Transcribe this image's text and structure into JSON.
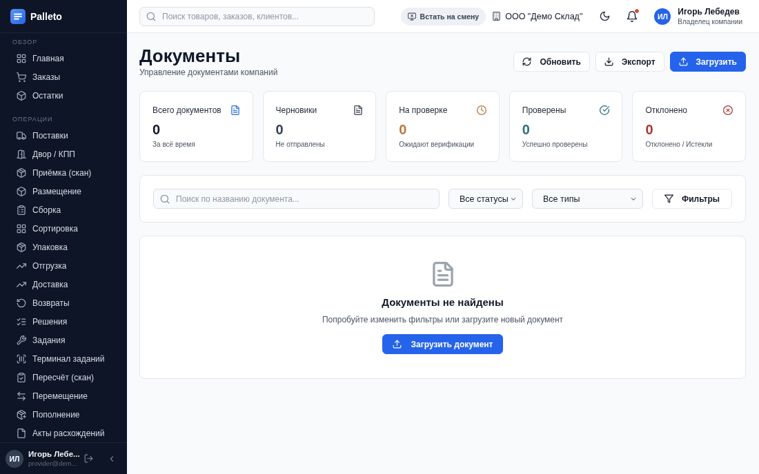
{
  "brand": {
    "name": "Palleto"
  },
  "sidebar": {
    "sections": [
      {
        "title": "ОБЗОР",
        "items": [
          {
            "label": "Главная",
            "selected": false
          },
          {
            "label": "Заказы",
            "selected": false
          },
          {
            "label": "Остатки",
            "selected": false
          }
        ]
      },
      {
        "title": "ОПЕРАЦИИ",
        "items": [
          {
            "label": "Поставки",
            "selected": false
          },
          {
            "label": "Двор / КПП",
            "selected": false
          },
          {
            "label": "Приёмка (скан)",
            "selected": false
          },
          {
            "label": "Размещение",
            "selected": false
          },
          {
            "label": "Сборка",
            "selected": false
          },
          {
            "label": "Сортировка",
            "selected": false
          },
          {
            "label": "Упаковка",
            "selected": false
          },
          {
            "label": "Отгрузка",
            "selected": false
          },
          {
            "label": "Доставка",
            "selected": false
          },
          {
            "label": "Возвраты",
            "selected": false
          },
          {
            "label": "Решения",
            "selected": false
          },
          {
            "label": "Задания",
            "selected": false
          },
          {
            "label": "Терминал заданий",
            "selected": false
          },
          {
            "label": "Пересчёт (скан)",
            "selected": false
          },
          {
            "label": "Перемещение",
            "selected": false
          },
          {
            "label": "Пополнение",
            "selected": false
          },
          {
            "label": "Акты расхождений",
            "selected": false
          }
        ]
      }
    ]
  },
  "sidebar_footer": {
    "avatar": "ИЛ",
    "name": "Игорь Лебе...",
    "email": "provider@dem..."
  },
  "topbar": {
    "search": {
      "placeholder": "Поиск товаров, заказов, клиентов..."
    },
    "shift_button": "Встать на смену",
    "company": "ООО \"Демо Склад\"",
    "notifications": {
      "unread": true
    },
    "user": {
      "avatar": "ИЛ",
      "name": "Игорь Лебедев",
      "role": "Владелец компании"
    }
  },
  "page": {
    "title": "Документы",
    "subtitle": "Управление документами компаний",
    "actions": [
      {
        "kind": "refresh",
        "label": "Обновить"
      },
      {
        "kind": "export",
        "label": "Экспорт"
      },
      {
        "kind": "upload",
        "label": "Загрузить"
      }
    ]
  },
  "stats": [
    {
      "kind": "total",
      "label": "Всего документов",
      "value": "0",
      "note": "За всё время",
      "color": "#2f6fdb"
    },
    {
      "kind": "drafts",
      "label": "Черновики",
      "value": "0",
      "note": "Не отправлены",
      "color": "#374151"
    },
    {
      "kind": "review",
      "label": "На проверке",
      "value": "0",
      "note": "Ожидают верификации",
      "color": "#b7793f"
    },
    {
      "kind": "verified",
      "label": "Проверены",
      "value": "0",
      "note": "Успешно проверены",
      "color": "#2f6f7e"
    },
    {
      "kind": "rejected",
      "label": "Отклонено",
      "value": "0",
      "note": "Отклонено / Истекли",
      "color": "#a83a30"
    }
  ],
  "filters": {
    "search": {
      "placeholder": "Поиск по названию документа..."
    },
    "status_select": "Все статусы",
    "type_select": "Все типы",
    "filter_button": "Фильтры"
  },
  "empty_state": {
    "title": "Документы не найдены",
    "message": "Попробуйте изменить фильтры или загрузите новый документ",
    "button": "Загрузить документ"
  }
}
